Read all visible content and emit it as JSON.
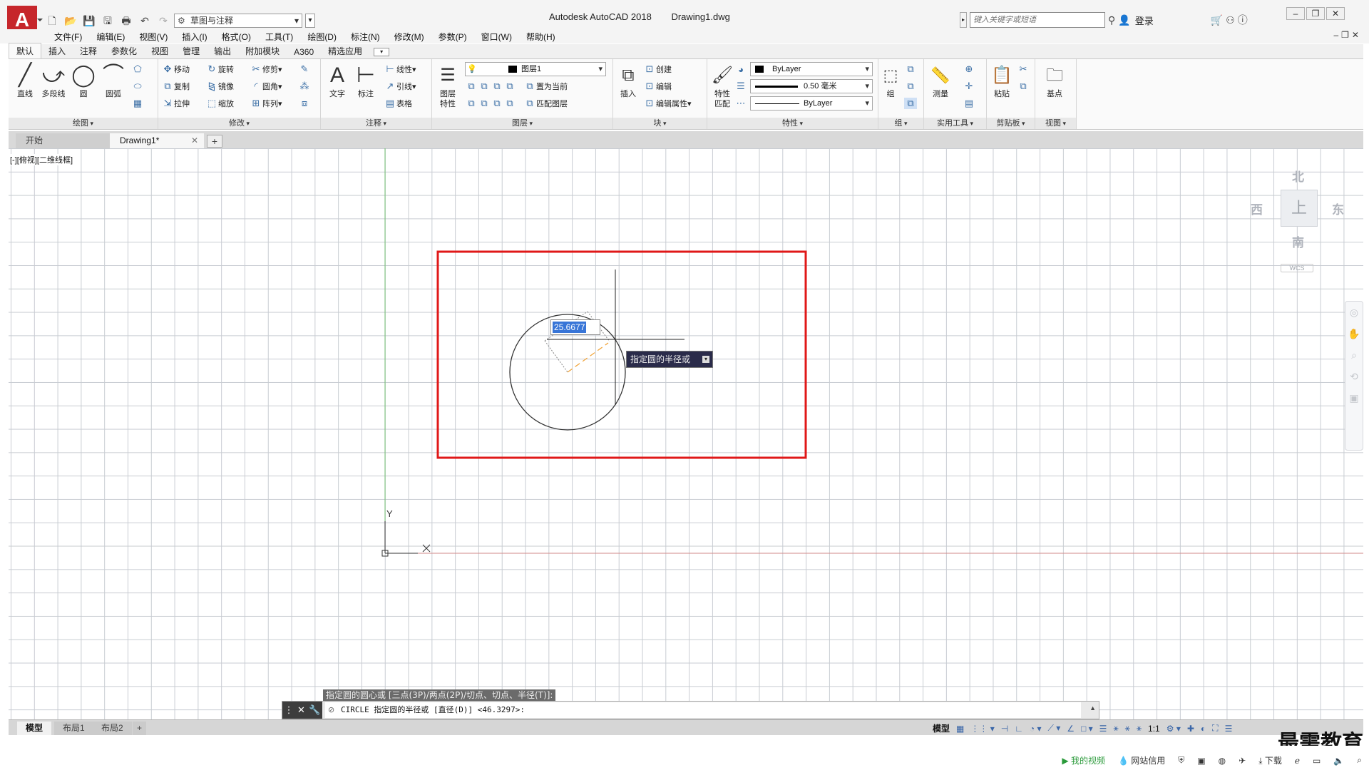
{
  "app": {
    "logo_letter": "A",
    "title": "Autodesk AutoCAD 2018",
    "document": "Drawing1.dwg",
    "workspace": "草图与注释",
    "search_placeholder": "键入关键字或短语",
    "login": "登录"
  },
  "menu": [
    "文件(F)",
    "编辑(E)",
    "视图(V)",
    "插入(I)",
    "格式(O)",
    "工具(T)",
    "绘图(D)",
    "标注(N)",
    "修改(M)",
    "参数(P)",
    "窗口(W)",
    "帮助(H)"
  ],
  "ribbon_tabs": [
    "默认",
    "插入",
    "注释",
    "参数化",
    "视图",
    "管理",
    "输出",
    "附加模块",
    "A360",
    "精选应用"
  ],
  "ribbon": {
    "draw": {
      "title": "绘图",
      "line": "直线",
      "polyline": "多段线",
      "circle": "圆",
      "arc": "圆弧"
    },
    "modify": {
      "title": "修改",
      "move": "移动",
      "rotate": "旋转",
      "trim": "修剪",
      "copy": "复制",
      "mirror": "镜像",
      "fillet": "圆角",
      "stretch": "拉伸",
      "scale": "缩放",
      "array": "阵列"
    },
    "annotation": {
      "title": "注释",
      "text": "文字",
      "dimension": "标注",
      "linear": "线性",
      "leader": "引线",
      "table": "表格"
    },
    "layers": {
      "title": "图层",
      "properties": "图层特性",
      "current_layer": "图层1",
      "make_current": "置为当前",
      "match_layer": "匹配图层"
    },
    "block": {
      "title": "块",
      "insert": "插入",
      "create": "创建",
      "edit": "编辑",
      "edit_attributes": "编辑属性"
    },
    "properties": {
      "title": "特性",
      "match": "特性匹配",
      "color": "ByLayer",
      "lineweight": "0.50 毫米",
      "linetype": "ByLayer"
    },
    "groups": {
      "title": "组",
      "group": "组"
    },
    "utilities": {
      "title": "实用工具",
      "measure": "测量"
    },
    "clipboard": {
      "title": "剪贴板",
      "paste": "粘贴"
    },
    "view": {
      "title": "视图",
      "base": "基点"
    }
  },
  "file_tabs": [
    {
      "label": "开始"
    },
    {
      "label": "Drawing1*"
    }
  ],
  "viewport_label": "[-][俯视][二维线框]",
  "viewcube": {
    "north": "北",
    "south": "南",
    "east": "东",
    "west": "西",
    "face": "上",
    "wcs": "WCS"
  },
  "axes": {
    "x": "X",
    "y": "Y"
  },
  "dynamic_input": {
    "value": "25.6677",
    "prompt": "指定圆的半径或"
  },
  "command": {
    "history": "指定圆的圆心或 [三点(3P)/两点(2P)/切点、切点、半径(T)]:",
    "current": "CIRCLE 指定圆的半径或 [直径(D)] <46.3297>:"
  },
  "layout_tabs": [
    "模型",
    "布局1",
    "布局2"
  ],
  "status": {
    "model": "模型",
    "scale": "1:1"
  },
  "os_strip": {
    "video": "我的视频",
    "credit": "网站信用",
    "download": "下载"
  },
  "watermark": "最需教育",
  "colors": {
    "highlight_red": "#e01818",
    "x_axis": "#d28a8a",
    "y_axis": "#6fbf6f",
    "tooltip_bg": "#2a2b4a",
    "selection": "#3875d7"
  }
}
